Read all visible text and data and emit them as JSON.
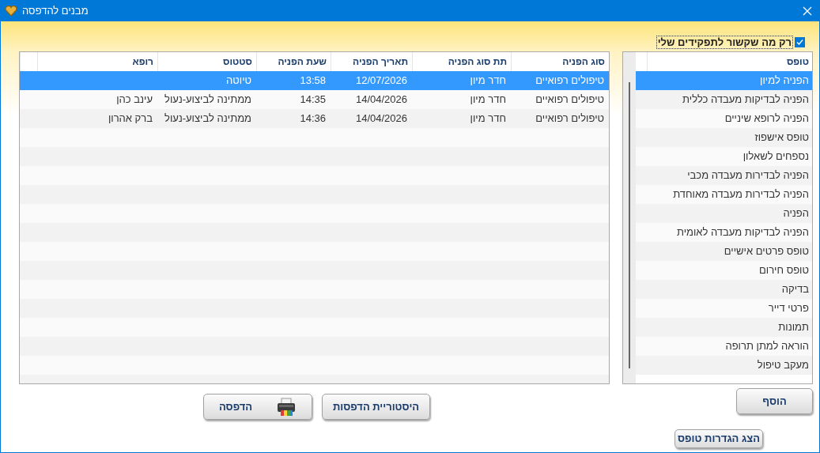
{
  "window": {
    "title": "מבנים להדפסה"
  },
  "filter": {
    "label": "רק מה שקשור לתפקידים שלי",
    "checked": true
  },
  "forms_list": {
    "header": "טופס",
    "items": [
      {
        "label": "הפניה למיון",
        "selected": true
      },
      {
        "label": "הפניה לבדיקות מעבדה כללית",
        "selected": false
      },
      {
        "label": "הפניה לרופא שיניים",
        "selected": false
      },
      {
        "label": "טופס אישפוז",
        "selected": false
      },
      {
        "label": "נספחים לשאלון",
        "selected": false
      },
      {
        "label": "הפניה לבדירות מעבדה מכבי",
        "selected": false
      },
      {
        "label": "הפניה לבדירות מעבדה מאוחדת",
        "selected": false
      },
      {
        "label": "הפניה",
        "selected": false
      },
      {
        "label": "הפניה לבדיקות מעבדה לאומית",
        "selected": false
      },
      {
        "label": "טופס פרטים אישיים",
        "selected": false
      },
      {
        "label": "טופס חירום",
        "selected": false
      },
      {
        "label": "בדיקה",
        "selected": false
      },
      {
        "label": "פרטי דייר",
        "selected": false
      },
      {
        "label": "תמונות",
        "selected": false
      },
      {
        "label": "הוראה למתן תרופה",
        "selected": false
      },
      {
        "label": "מעקב טיפול",
        "selected": false
      }
    ]
  },
  "table": {
    "columns": [
      "סוג הפניה",
      "תת סוג הפניה",
      "תאריך הפניה",
      "שעת הפניה",
      "סטטוס",
      "רופא"
    ],
    "rows": [
      {
        "cells": [
          "טיפולים רפואיים",
          "חדר מיון",
          "12/07/2026",
          "13:58",
          "טיוטה"
        ],
        "selected": true
      },
      {
        "cells": [
          "טיפולים רפואיים",
          "חדר מיון",
          "14/04/2026",
          "14:35",
          "ממתינה לביצוע-נעול",
          "עינב כהן"
        ],
        "selected": false
      },
      {
        "cells": [
          "טיפולים רפואיים",
          "חדר מיון",
          "14/04/2026",
          "14:36",
          "ממתינה לביצוע-נעול",
          "ברק אהרון"
        ],
        "selected": false
      }
    ]
  },
  "buttons": {
    "add": "הוסף",
    "show_settings": "הצג הגדרות טופס",
    "print_history": "היסטוריית הדפסות",
    "print": "הדפסה"
  }
}
